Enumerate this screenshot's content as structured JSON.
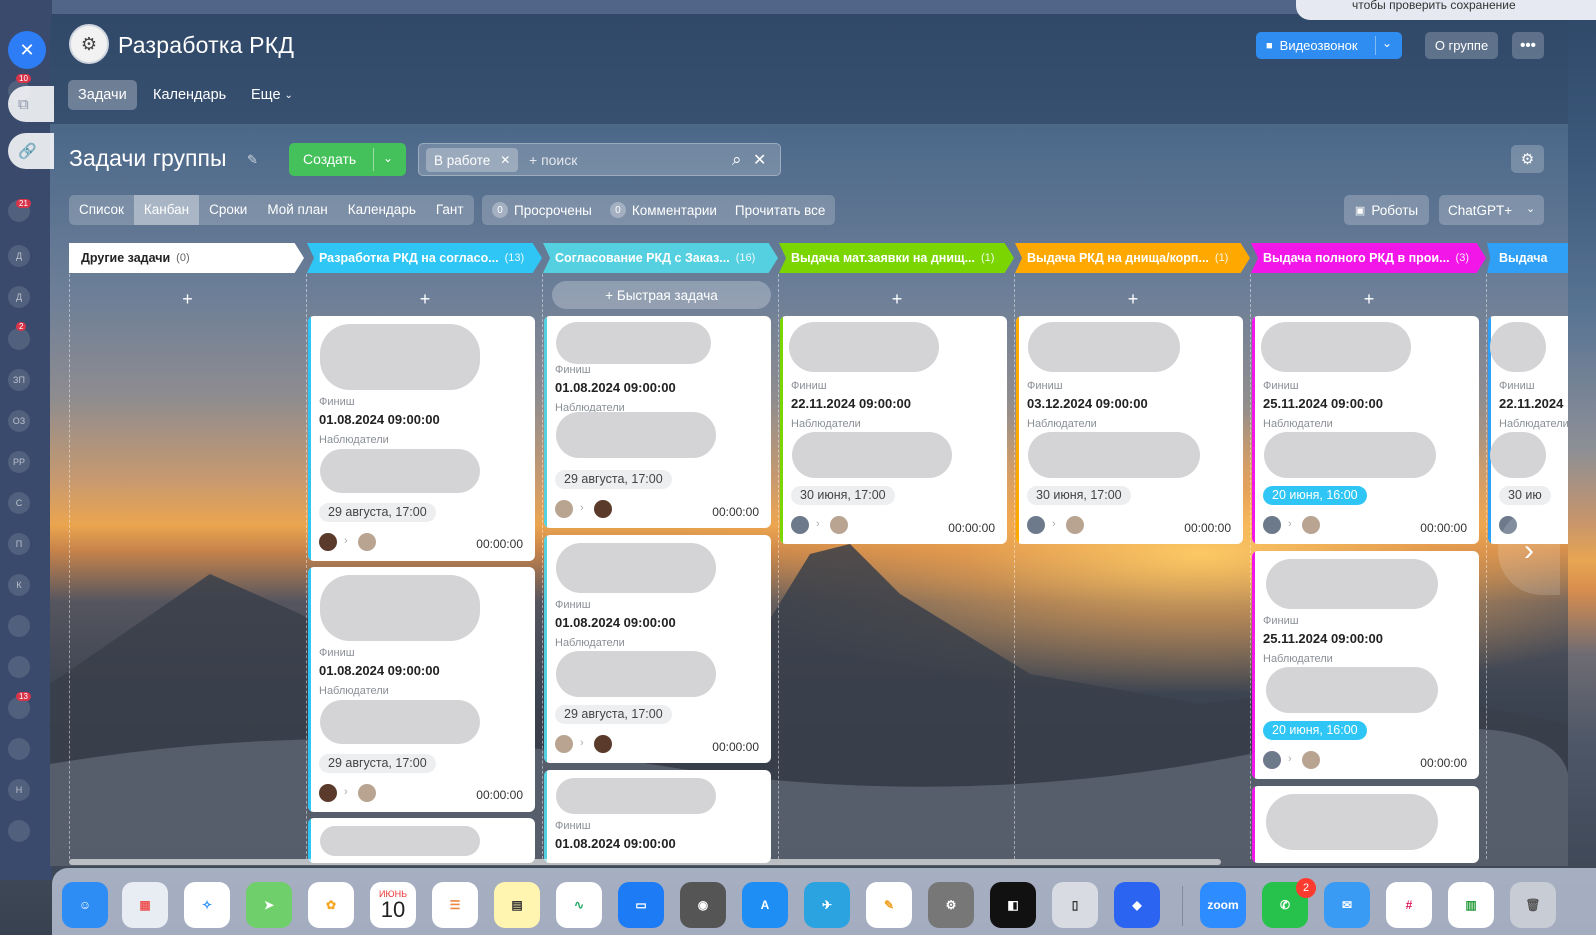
{
  "group": {
    "title": "Разработка РКД"
  },
  "header": {
    "video_label": "Видеозвонок",
    "about_label": "О группе",
    "more_label": "•••"
  },
  "nav": {
    "tabs": [
      "Задачи",
      "Календарь",
      "Еще"
    ]
  },
  "page": {
    "title": "Задачи группы"
  },
  "toolbar": {
    "create_label": "Создать",
    "filter_chip": "В работе",
    "search_placeholder": "+ поиск",
    "views": [
      "Список",
      "Канбан",
      "Сроки",
      "Мой план",
      "Календарь",
      "Гант"
    ],
    "counters": [
      {
        "num": "0",
        "label": "Просрочены"
      },
      {
        "num": "0",
        "label": "Комментарии"
      }
    ],
    "read_all": "Прочитать все",
    "robots_label": "Роботы",
    "gpt_label": "ChatGPT+"
  },
  "notification": {
    "text": "чтобы проверить сохранение"
  },
  "columns": [
    {
      "title": "Другие задачи",
      "count": "(0)",
      "color": "#ffffff"
    },
    {
      "title": "Разработка РКД на согласо...",
      "count": "(13)",
      "color": "#2fc6f6"
    },
    {
      "title": "Согласование РКД с Заказ...",
      "count": "(16)",
      "color": "#55d0e0"
    },
    {
      "title": "Выдача мат.заявки на днищ...",
      "count": "(1)",
      "color": "#7bd500"
    },
    {
      "title": "Выдача РКД на днища/корп...",
      "count": "(1)",
      "color": "#ffa900"
    },
    {
      "title": "Выдача полного РКД в прои...",
      "count": "(3)",
      "color": "#f316e8"
    },
    {
      "title": "Выдача",
      "count": "",
      "color": "#2fa0f6"
    }
  ],
  "labels": {
    "quick_task": "+ Быстрая задача",
    "add": "+",
    "finish": "Финиш",
    "observers": "Наблюдатели",
    "time": "00:00:00"
  },
  "cards": {
    "c1a": {
      "date": "01.08.2024 09:00:00",
      "deadline": "29 августа, 17:00"
    },
    "c1b": {
      "date": "01.08.2024 09:00:00",
      "deadline": "29 августа, 17:00"
    },
    "c2a": {
      "date": "01.08.2024 09:00:00",
      "deadline": "29 августа, 17:00"
    },
    "c2b": {
      "date": "01.08.2024 09:00:00",
      "deadline": "29 августа, 17:00"
    },
    "c2c": {
      "date": "01.08.2024 09:00:00"
    },
    "c3a": {
      "date": "22.11.2024 09:00:00",
      "deadline": "30 июня, 17:00"
    },
    "c4a": {
      "date": "03.12.2024 09:00:00",
      "deadline": "30 июня, 17:00"
    },
    "c5a": {
      "date": "25.11.2024 09:00:00",
      "deadline": "20 июня, 16:00"
    },
    "c5b": {
      "date": "25.11.2024 09:00:00",
      "deadline": "20 июня, 16:00"
    },
    "c6a": {
      "date": "22.11.2024",
      "deadline": "30 ию"
    }
  },
  "dock": {
    "calendar_month": "ИЮНЬ",
    "calendar_day": "10",
    "zoom_label": "zoom",
    "whatsapp_badge": "2"
  }
}
